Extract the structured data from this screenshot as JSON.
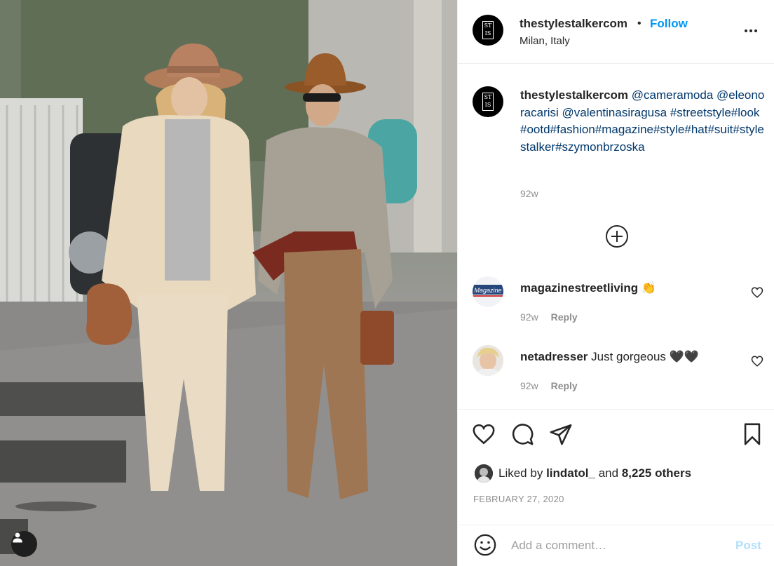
{
  "post": {
    "username": "thestylestalkercom",
    "follow_label": "Follow",
    "separator": "•",
    "location": "Milan, Italy",
    "avatar_monogram_top": "ST",
    "avatar_monogram_bottom": "IS",
    "more_icon": "more-horizontal-icon"
  },
  "caption": {
    "username": "thestylestalkercom",
    "mention_1": "@cameramoda",
    "mention_2": "@eleonoracarisi",
    "mention_3": "@valentinasiragusa",
    "hashtags": "#streetstyle#look#ootd#fashion#magazine#style#hat#suit#stylestalker#szymonbrzoska",
    "time": "92w"
  },
  "comments": [
    {
      "username": "magazinestreetliving",
      "text": "👏",
      "time": "92w",
      "reply_label": "Reply",
      "avatar_text": "Magazine"
    },
    {
      "username": "netadresser",
      "text": "Just gorgeous 🖤🖤",
      "time": "92w",
      "reply_label": "Reply"
    }
  ],
  "actions": {
    "liked_by_prefix": "Liked by",
    "liked_by_user": "lindatol_",
    "liked_by_mid": "and",
    "liked_by_count": "8,225 others",
    "date": "FEBRUARY 27, 2020"
  },
  "comment_box": {
    "placeholder": "Add a comment…",
    "post_label": "Post"
  },
  "colors": {
    "accent": "#0095f6",
    "link": "#00376b",
    "muted": "#8e8e8e",
    "post_disabled": "#b2dffc"
  }
}
